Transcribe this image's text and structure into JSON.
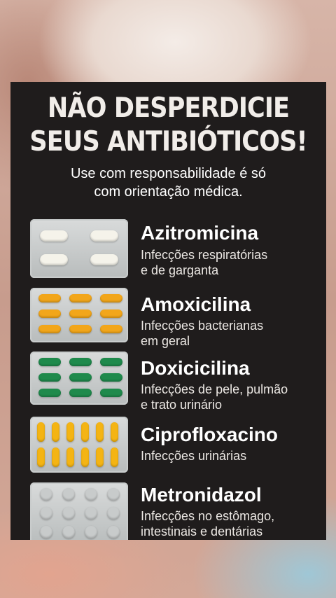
{
  "headline": {
    "line1": "NÃO DESPERDICIE",
    "line2": "SEUS ANTIBIÓTICOS!"
  },
  "subtitle": {
    "line1": "Use com responsabilidade é só",
    "line2": "com orientação médica."
  },
  "antibiotics": [
    {
      "name": "Azitromicina",
      "desc1": "Infecções respiratórias",
      "desc2": "e de garganta",
      "pill_color": "#f5f3ea",
      "pill_icon": "white-tablets-pack-icon"
    },
    {
      "name": "Amoxicilina",
      "desc1": "Infecções bacterianas",
      "desc2": "em geral",
      "pill_color": "#f2a61a",
      "pill_icon": "orange-capsules-pack-icon"
    },
    {
      "name": "Doxicicilina",
      "desc1": "Infecções de pele, pulmão",
      "desc2": "e trato urinário",
      "pill_color": "#1f8a4c",
      "pill_icon": "green-capsules-pack-icon"
    },
    {
      "name": "Ciprofloxacino",
      "desc1": "Infecções urinárias",
      "desc2": "",
      "pill_color": "#f4b413",
      "pill_icon": "yellow-capsules-pack-icon"
    },
    {
      "name": "Metronidazol",
      "desc1": "Infecções no estômago,",
      "desc2": "intestinais e dentárias",
      "pill_color": "#c8cbcb",
      "pill_icon": "round-tablets-pack-icon"
    }
  ]
}
